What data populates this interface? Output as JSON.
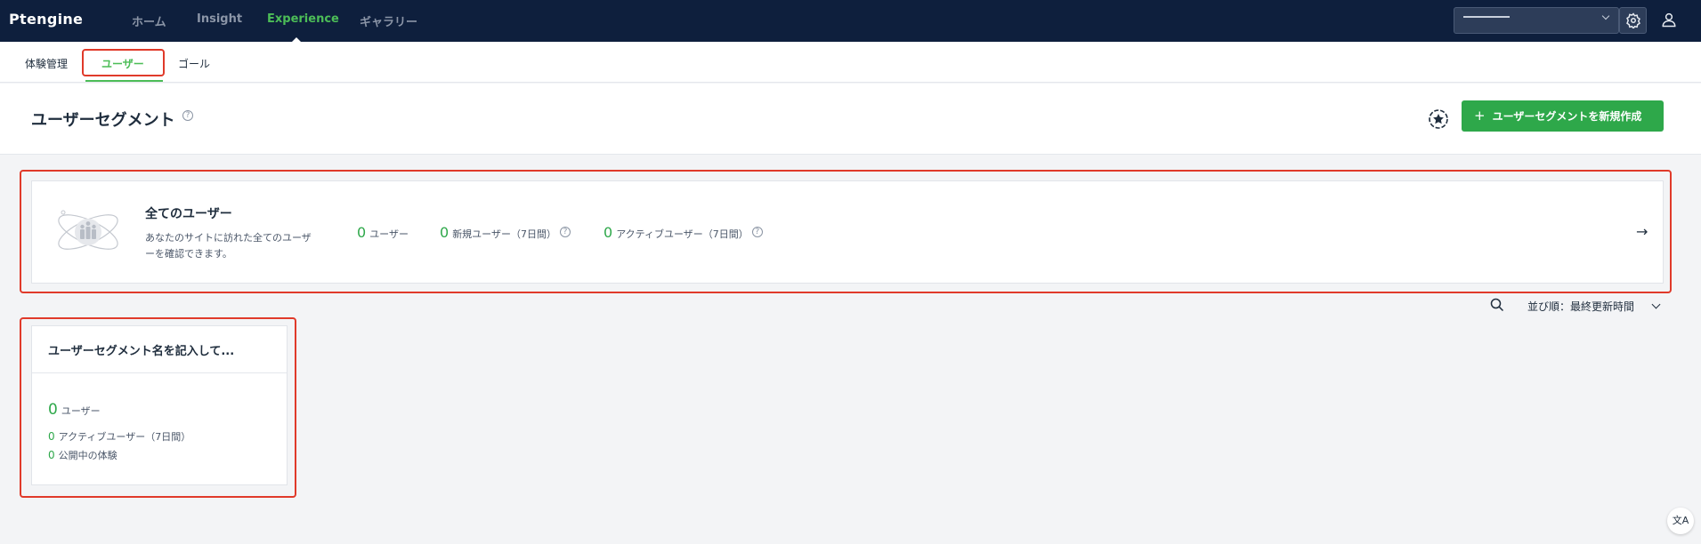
{
  "app": {
    "logo": "Ptengine"
  },
  "topnav": [
    {
      "label": "ホーム",
      "active": false
    },
    {
      "label": "Insight",
      "active": false
    },
    {
      "label": "Experience",
      "active": true
    },
    {
      "label": "ギャラリー",
      "active": false
    }
  ],
  "subnav": [
    {
      "label": "体験管理",
      "active": false
    },
    {
      "label": "ユーザー",
      "active": true
    },
    {
      "label": "ゴール",
      "active": false
    }
  ],
  "header": {
    "title": "ユーザーセグメント",
    "create_label": "ユーザーセグメントを新規作成"
  },
  "all_users": {
    "title": "全てのユーザー",
    "description": "あなたのサイトに訪れた全てのユーザーを確認できます。",
    "stats": [
      {
        "value": "0",
        "label": "ユーザー"
      },
      {
        "value": "0",
        "label": "新規ユーザー（7日間）"
      },
      {
        "value": "0",
        "label": "アクティブユーザー（7日間）"
      }
    ]
  },
  "sort": {
    "label": "並び順：",
    "value": "最終更新時間"
  },
  "segments": [
    {
      "name": "ユーザーセグメント名を記入して...",
      "users_value": "0",
      "users_label": "ユーザー",
      "active_value": "0",
      "active_label": "アクティブユーザー（7日間）",
      "exp_value": "0",
      "exp_label": "公開中の体験"
    }
  ],
  "colors": {
    "nav_bg": "#0e1f3d",
    "accent": "#2ea84a",
    "highlight": "#e03a2a"
  }
}
